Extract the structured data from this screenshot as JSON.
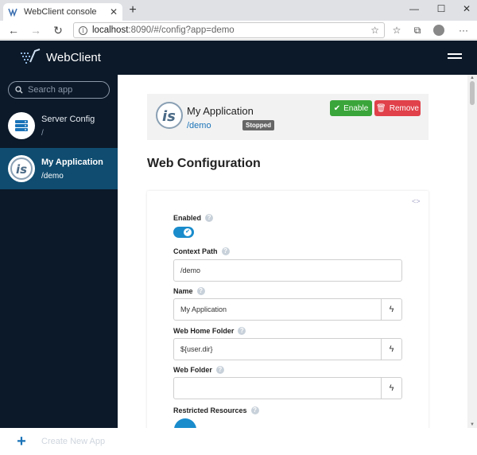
{
  "browser": {
    "tab_title": "WebClient console",
    "tab_close": "✕",
    "new_tab": "+",
    "url_host": "localhost",
    "url_rest": ":8090/#/config?app=demo",
    "minimize": "—",
    "maximize": "☐",
    "close": "✕",
    "more": "···"
  },
  "app": {
    "brand": "WebClient",
    "search_placeholder": "Search app",
    "sidebar_items": [
      {
        "name": "Server Config",
        "path": "/",
        "icon": "server-icon",
        "active": false
      },
      {
        "name": "My Application",
        "path": "/demo",
        "icon": "is-logo-icon",
        "active": true
      }
    ],
    "create_new_app": "Create New App"
  },
  "header": {
    "title": "My Application",
    "context": "/demo",
    "status": "Stopped",
    "enable_label": "Enable",
    "remove_label": "Remove"
  },
  "section_title": "Web Configuration",
  "form": {
    "enabled_label": "Enabled",
    "enabled": true,
    "context_path_label": "Context Path",
    "context_path_value": "/demo",
    "name_label": "Name",
    "name_value": "My Application",
    "web_home_label": "Web Home Folder",
    "web_home_value": "${user.dir}",
    "web_folder_label": "Web Folder",
    "web_folder_value": "",
    "restricted_label": "Restricted Resources",
    "help": "?"
  },
  "colors": {
    "sidebar_bg": "#0c1929",
    "active_item": "#0f4c70",
    "enable": "#3aa53a",
    "remove": "#e0414a",
    "link": "#1a73b8",
    "toggle": "#1a8ccc"
  }
}
